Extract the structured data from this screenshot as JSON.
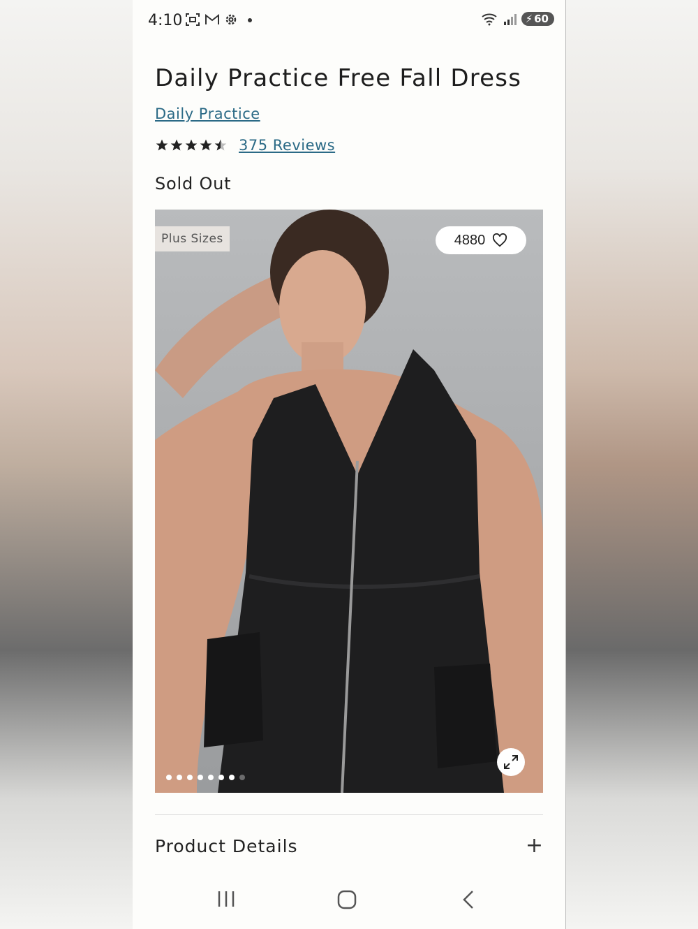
{
  "status_bar": {
    "time": "4:10",
    "battery": "60"
  },
  "product": {
    "title": "Daily Practice Free Fall Dress",
    "brand": "Daily Practice",
    "rating": 4.5,
    "reviews_label": "375 Reviews",
    "availability": "Sold Out"
  },
  "gallery": {
    "badge": "Plus Sizes",
    "favorites_count": "4880",
    "slide_count": 8,
    "active_slide": 1
  },
  "sections": {
    "details_label": "Product Details",
    "details_toggle": "+"
  },
  "icons": {
    "favorite": "heart-icon",
    "expand": "expand-icon",
    "nav_recents": "recents-icon",
    "nav_home": "home-icon",
    "nav_back": "back-icon"
  },
  "colors": {
    "link": "#2b6a86",
    "background": "#fdfdfb",
    "text": "#222222"
  }
}
